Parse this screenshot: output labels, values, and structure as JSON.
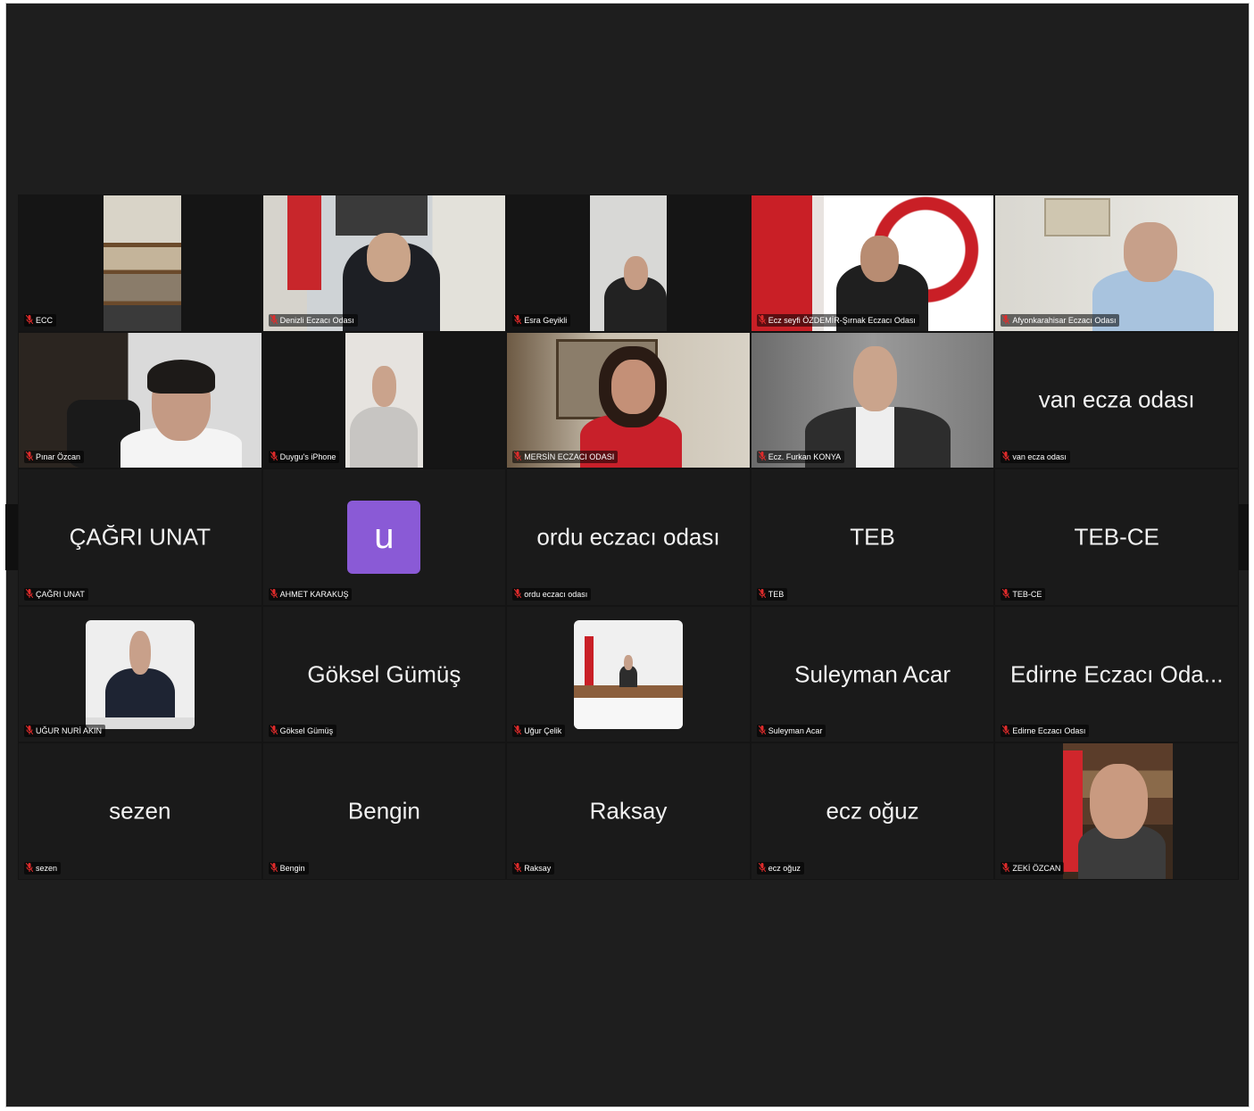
{
  "tiles": [
    {
      "label": "ECC",
      "kind": "video",
      "scene": "shelf"
    },
    {
      "label": "Denizli Eczacı Odası",
      "kind": "video",
      "scene": "office-flag"
    },
    {
      "label": "Esra Geyikli",
      "kind": "video",
      "scene": "small-portrait"
    },
    {
      "label": "Ecz seyfi ÖZDEMİR-Şırnak Eczacı Odası",
      "kind": "video",
      "scene": "flag-logo"
    },
    {
      "label": "Afyonkarahisar Eczacı Odası",
      "kind": "video",
      "scene": "office-light"
    },
    {
      "label": "Pınar Özcan",
      "kind": "video",
      "scene": "woman-glasses"
    },
    {
      "label": "Duygu's iPhone",
      "kind": "video",
      "scene": "phone-portrait"
    },
    {
      "label": "MERSİN ECZACI ODASI",
      "kind": "video",
      "scene": "woman-red"
    },
    {
      "label": "Ecz. Furkan KONYA",
      "kind": "video",
      "scene": "man-suit"
    },
    {
      "label": "van ecza odası",
      "kind": "name",
      "name": "van ecza odası"
    },
    {
      "label": "ÇAĞRI UNAT",
      "kind": "name",
      "name": "ÇAĞRI UNAT"
    },
    {
      "label": "AHMET KARAKUŞ",
      "kind": "avatar",
      "initial": "u"
    },
    {
      "label": "ordu eczacı odası",
      "kind": "name",
      "name": "ordu eczacı odası"
    },
    {
      "label": "TEB",
      "kind": "name",
      "name": "TEB"
    },
    {
      "label": "TEB-CE",
      "kind": "name",
      "name": "TEB-CE"
    },
    {
      "label": "UĞUR NURİ AKIN",
      "kind": "thumb",
      "scene": "speaker-podium"
    },
    {
      "label": "Göksel Gümüş",
      "kind": "name",
      "name": "Göksel Gümüş"
    },
    {
      "label": "Uğur Çelik",
      "kind": "thumb",
      "scene": "desk-flag"
    },
    {
      "label": "Suleyman Acar",
      "kind": "name",
      "name": "Suleyman Acar"
    },
    {
      "label": "Edirne Eczacı Odası",
      "kind": "name",
      "name": "Edirne Eczacı Oda..."
    },
    {
      "label": "sezen",
      "kind": "name",
      "name": "sezen"
    },
    {
      "label": "Bengin",
      "kind": "name",
      "name": "Bengin"
    },
    {
      "label": "Raksay",
      "kind": "name",
      "name": "Raksay"
    },
    {
      "label": "ecz oğuz",
      "kind": "name",
      "name": "ecz oğuz"
    },
    {
      "label": "ZEKİ ÖZCAN",
      "kind": "video",
      "scene": "bookshelf-man"
    }
  ],
  "colors": {
    "background": "#1e1e1e",
    "avatar": "#8a5ad6",
    "mute": "#e02b2b"
  }
}
